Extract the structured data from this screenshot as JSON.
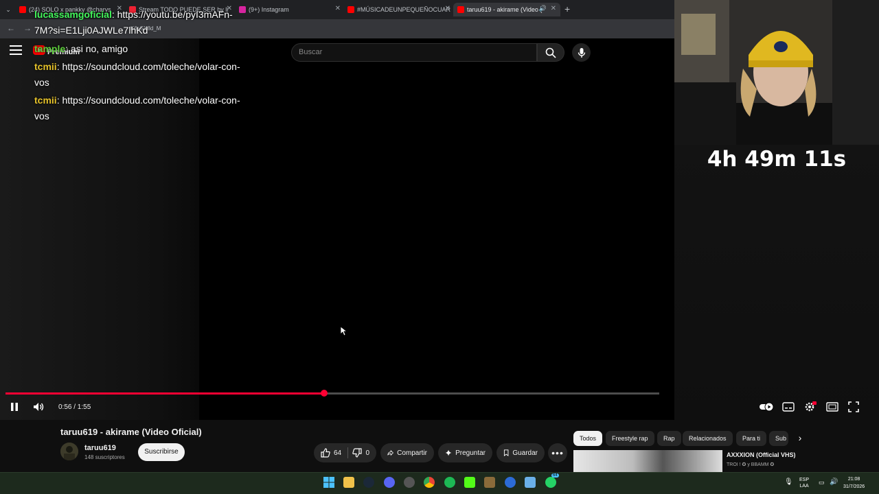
{
  "browser": {
    "tabs": [
      {
        "title": "(24) SOLO x pankky @charvs",
        "favicon_color": "#ff0000"
      },
      {
        "title": "Stream TODO PUEDE SER by li",
        "favicon_color": "#e23"
      },
      {
        "title": "(9+) Instagram",
        "favicon_color": "#d6249f"
      },
      {
        "title": "#MÚSICADEUNPEQUEÑOCUAR",
        "favicon_color": "#ff0000"
      },
      {
        "title": "taruu619 - akirame (Video (",
        "favicon_color": "#ff0000"
      }
    ],
    "url": "K6sSX8d_M"
  },
  "youtube": {
    "logo_text": "Premium",
    "search_placeholder": "Buscar"
  },
  "chat": [
    {
      "user": "lucassamgoficial",
      "user_color": "#42f55a",
      "message": ": https://youtu.be/pyI3mAFn-7M?si=E1Lji0AJWLe7lhKd"
    },
    {
      "user": "tample",
      "user_color": "#5ecf3c",
      "message": ": asi no, amigo"
    },
    {
      "user": "tcmii",
      "user_color": "#e6c229",
      "message": ": https://soundcloud.com/toleche/volar-con-vos"
    },
    {
      "user": "tcmii",
      "user_color": "#e6c229",
      "message": ": https://soundcloud.com/toleche/volar-con-vos"
    }
  ],
  "player": {
    "time": "0:56 / 1:55",
    "progress": 0.4869
  },
  "overlay": {
    "timer": "4h 49m 11s"
  },
  "video": {
    "title": "taruu619 - akirame (Video Oficial)",
    "channel": "taruu619",
    "subscribers": "148 suscriptores",
    "subscribe_label": "Suscribirse",
    "likes": "64",
    "dislikes": "0",
    "share_label": "Compartir",
    "ask_label": "Preguntar",
    "save_label": "Guardar"
  },
  "chips": [
    "Todos",
    "Freestyle rap",
    "Rap",
    "Relacionados",
    "Para ti",
    "Sub"
  ],
  "recommendation": {
    "title": "AXXXION (Official VHS)",
    "artist": "TROI ! ✪ y BBAMM ✪"
  },
  "taskbar": {
    "lang_line1": "ESP",
    "lang_line2": "LAA",
    "time": "21:08",
    "date": "31/7/2026",
    "whatsapp_badge": "64"
  },
  "colors": {
    "accent": "#ff0033",
    "background": "#0f0f0f"
  }
}
